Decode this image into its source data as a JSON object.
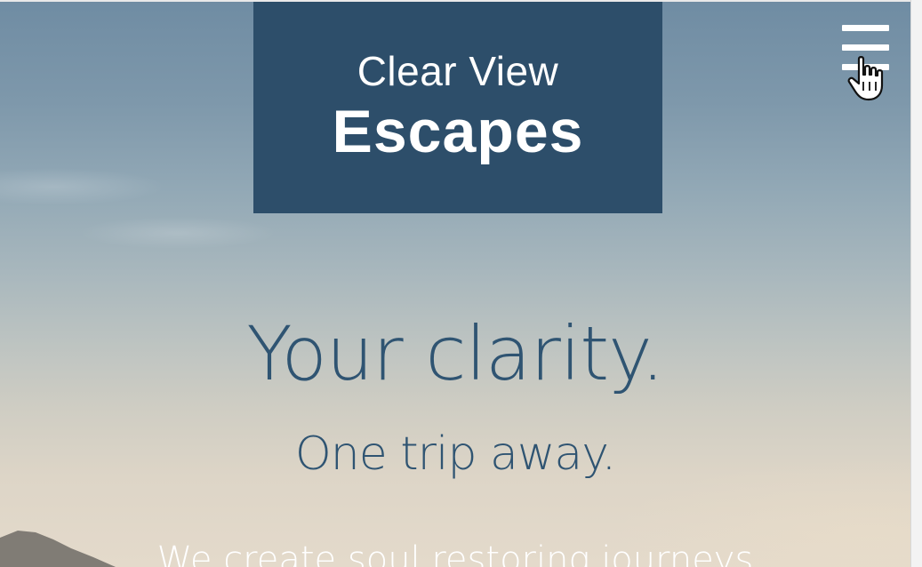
{
  "brand": {
    "line1": "Clear View",
    "line2": "Escapes"
  },
  "menu": {
    "icon": "hamburger-menu-icon",
    "cursor": "hand-pointer-cursor"
  },
  "hero": {
    "title": "Your clarity.",
    "subtitle": "One trip away.",
    "body": "We create soul restoring journeys"
  },
  "colors": {
    "brand_box": "#2d4e6a",
    "heading_text": "#2f5472",
    "body_text": "#ffffff"
  }
}
